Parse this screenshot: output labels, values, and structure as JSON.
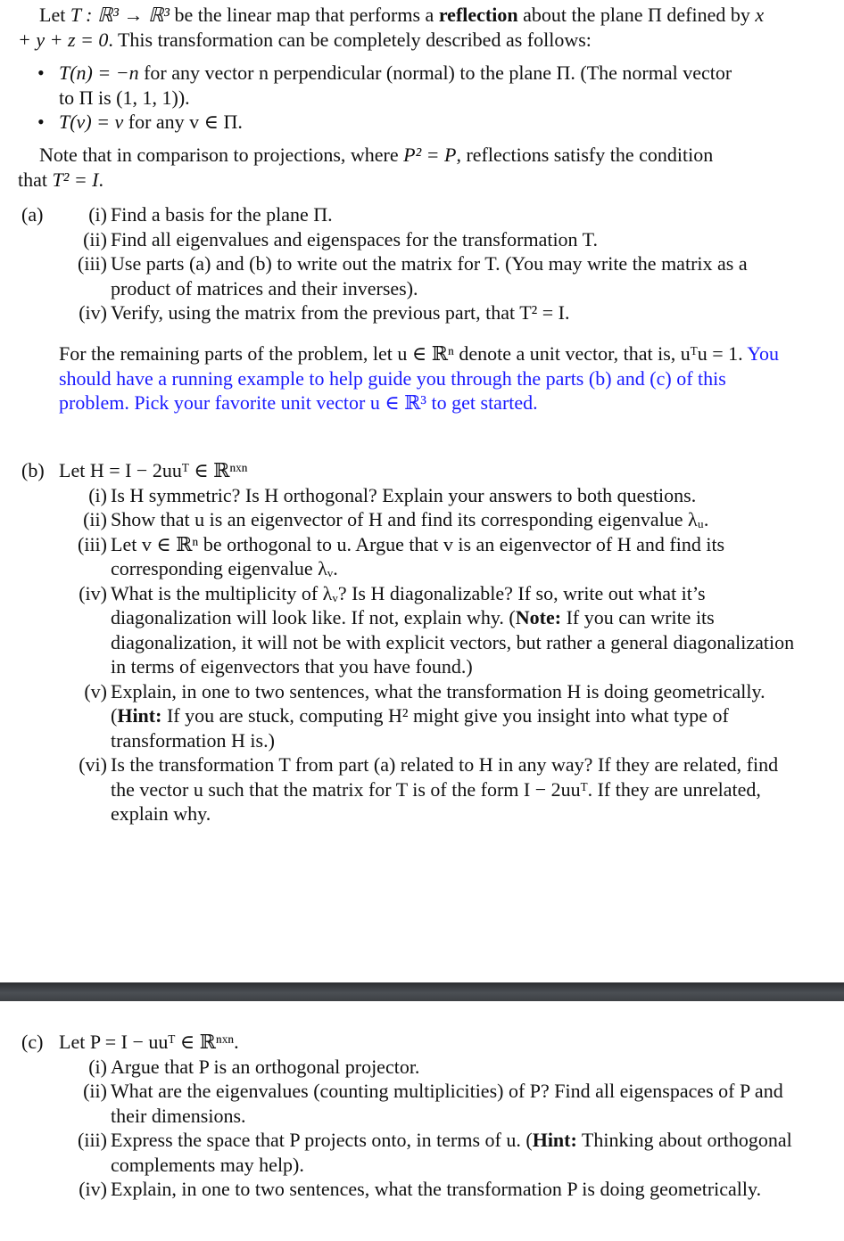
{
  "intro": {
    "line1_pre": "Let ",
    "map": "T : ℝ³ → ℝ³",
    "line1_mid": " be the linear map that performs a ",
    "bold_word": "reflection",
    "line1_post": " about the plane Π defined by ",
    "equation": "x + y + z = 0",
    "line2_post": ". This transformation can be completely described as follows:"
  },
  "bullets": [
    {
      "math": "T(n) = −n",
      "text": " for any vector n perpendicular (normal) to the plane Π. (The normal vector to Π is (1, 1, 1))."
    },
    {
      "math": "T(v) = v",
      "text": " for any v ∈ Π."
    }
  ],
  "note": {
    "text_pre": "Note that in comparison to projections, where ",
    "math1": "P² = P",
    "text_mid": ", reflections satisfy the condition that ",
    "math2": "T² = I",
    "text_post": "."
  },
  "part_a": {
    "label": "(a)",
    "items": [
      {
        "num": "(i)",
        "text": "Find a basis for the plane Π."
      },
      {
        "num": "(ii)",
        "text": "Find all eigenvalues and eigenspaces for the transformation T."
      },
      {
        "num": "(iii)",
        "text": "Use parts (a) and (b) to write out the matrix for T. (You may write the matrix as a product of matrices and their inverses)."
      },
      {
        "num": "(iv)",
        "text": "Verify, using the matrix from the previous part, that T² = I."
      }
    ]
  },
  "remaining": {
    "black": "For the remaining parts of the problem, let u ∈ ℝⁿ denote a unit vector, that is, uᵀu = 1.",
    "blue": " You should have a running example to help guide you through the parts (b) and (c) of this problem. Pick your favorite unit vector u ∈ ℝ³ to get started.",
    "blue_color": "#1a1aff"
  },
  "part_b": {
    "label": "(b)",
    "heading": "Let H = I − 2uuᵀ ∈ ℝⁿˣⁿ",
    "items": [
      {
        "num": "(i)",
        "text": "Is H symmetric? Is H orthogonal? Explain your answers to both questions."
      },
      {
        "num": "(ii)",
        "text": "Show that u is an eigenvector of H and find its corresponding eigenvalue λᵤ."
      },
      {
        "num": "(iii)",
        "text": "Let v ∈ ℝⁿ be orthogonal to u. Argue that v is an eigenvector of H and find its corresponding eigenvalue λᵥ."
      },
      {
        "num": "(iv)",
        "text_pre": "What is the multiplicity of λᵥ? Is H diagonalizable? If so, write out what it’s diagonalization will look like. If not, explain why. (",
        "bold": "Note:",
        "text_post": " If you can write its diagonalization, it will not be with explicit vectors, but rather a general diagonalization in terms of eigenvectors that you have found.)"
      },
      {
        "num": "(v)",
        "text_pre": "Explain, in one to two sentences, what the transformation H is doing geometrically. (",
        "bold": "Hint:",
        "text_post": " If you are stuck, computing H² might give you insight into what type of transformation H is.)"
      },
      {
        "num": "(vi)",
        "text": "Is the transformation T from part (a) related to H in any way? If they are related, find the vector u such that the matrix for T is of the form I − 2uuᵀ. If they are unrelated, explain why."
      }
    ]
  },
  "part_c": {
    "label": "(c)",
    "heading": "Let P = I − uuᵀ ∈ ℝⁿˣⁿ.",
    "items": [
      {
        "num": "(i)",
        "text": "Argue that P is an orthogonal projector."
      },
      {
        "num": "(ii)",
        "text": "What are the eigenvalues (counting multiplicities) of P? Find all eigenspaces of P and their dimensions."
      },
      {
        "num": "(iii)",
        "text_pre": "Express the space that P projects onto, in terms of u. (",
        "bold": "Hint:",
        "text_post": " Thinking about orthogonal complements may help)."
      },
      {
        "num": "(iv)",
        "text": "Explain, in one to two sentences, what the transformation P is doing geometrically."
      }
    ]
  }
}
